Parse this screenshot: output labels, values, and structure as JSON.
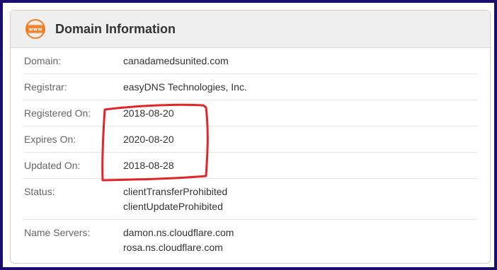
{
  "card": {
    "title": "Domain Information",
    "icon": "www-globe-icon",
    "icon_text": "www",
    "accent_color": "#f47c20"
  },
  "rows": [
    {
      "label": "Domain:",
      "values": [
        "canadamedsunited.com"
      ]
    },
    {
      "label": "Registrar:",
      "values": [
        "easyDNS Technologies, Inc."
      ]
    },
    {
      "label": "Registered On:",
      "values": [
        "2018-08-20"
      ]
    },
    {
      "label": "Expires On:",
      "values": [
        "2020-08-20"
      ]
    },
    {
      "label": "Updated On:",
      "values": [
        "2018-08-28"
      ]
    },
    {
      "label": "Status:",
      "values": [
        "clientTransferProhibited",
        "clientUpdateProhibited"
      ]
    },
    {
      "label": "Name Servers:",
      "values": [
        "damon.ns.cloudflare.com",
        "rosa.ns.cloudflare.com"
      ]
    }
  ],
  "annotation": {
    "color": "#e0252b",
    "shape": "hand-drawn rectangle around dates"
  }
}
